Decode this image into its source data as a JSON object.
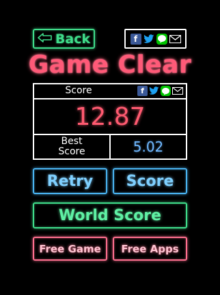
{
  "header": {
    "back_label": "Back"
  },
  "share": {
    "facebook_glyph": "f",
    "twitter_glyph": "🐦",
    "line_glyph": "LINE",
    "icons": [
      "facebook-icon",
      "twitter-icon",
      "line-icon",
      "mail-icon"
    ]
  },
  "title": "Game Clear",
  "score_panel": {
    "score_label": "Score",
    "score_value": "12.87",
    "best_label_line1": "Best",
    "best_label_line2": "Score",
    "best_value": "5.02"
  },
  "buttons": {
    "retry": "Retry",
    "score": "Score",
    "world_score": "World Score",
    "free_game": "Free Game",
    "free_apps": "Free Apps"
  },
  "colors": {
    "background": "#000000",
    "accent_green": "#3fdc8a",
    "accent_pink": "#ff5a78",
    "accent_blue": "#4ab3f0",
    "best_value": "#6fb8ff"
  }
}
